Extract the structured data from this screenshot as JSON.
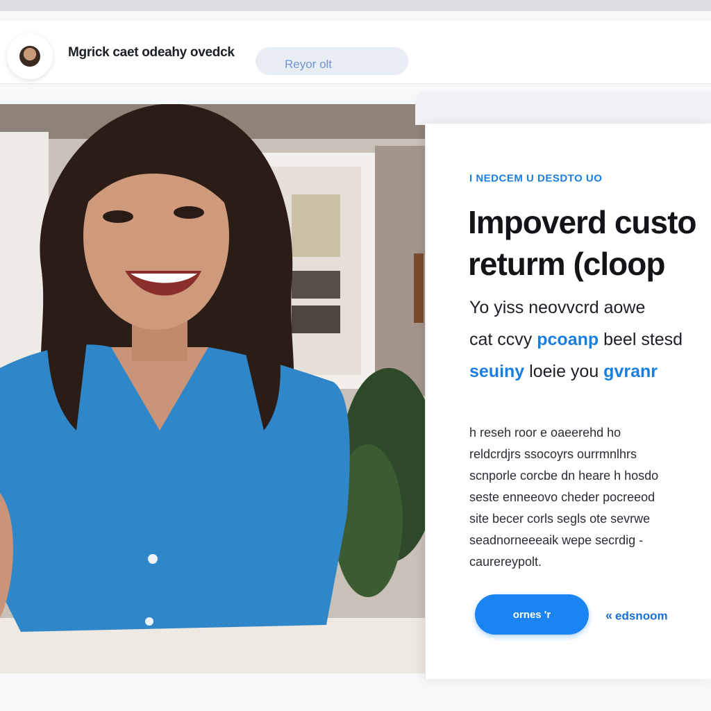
{
  "header": {
    "avatar_icon": "user-avatar-icon",
    "brand_text": "Mgrick caet odeahy ovedck",
    "search_text": "Reyor olt"
  },
  "hero": {
    "image_description_icon": "photo-icon"
  },
  "card": {
    "eyebrow": "I NEDCEM U DESDTO UO",
    "headline_lines": [
      "Impoverd custo",
      "returm (cloop"
    ],
    "subhead_lines": [
      [
        "Yo yiss neovvcrd aowe",
        ""
      ],
      [
        "cat ccvy ",
        "pcoanp",
        " beel stesd"
      ],
      [
        "",
        "seuiny",
        " loeie you ",
        "gvranr"
      ]
    ],
    "body_lines": [
      "h reseh roor e oaeerehd ho",
      "reldcrdjrs ssocoyrs ourrmnlhrs",
      "scnporle corcbe dn heare h hosdo",
      "seste enneeovo cheder pocreeod",
      "site becer corls segls ote sevrwe",
      "seadnorneeeaik wepe secrdig -",
      "caurereypolt."
    ],
    "cta_label": "ornes 'r",
    "secondary_label": "edsnoom",
    "secondary_icon": "chevron-left-double-icon"
  },
  "colors": {
    "accent": "#1a85f2",
    "accent_text": "#1a7ee0",
    "headline": "#121418"
  }
}
